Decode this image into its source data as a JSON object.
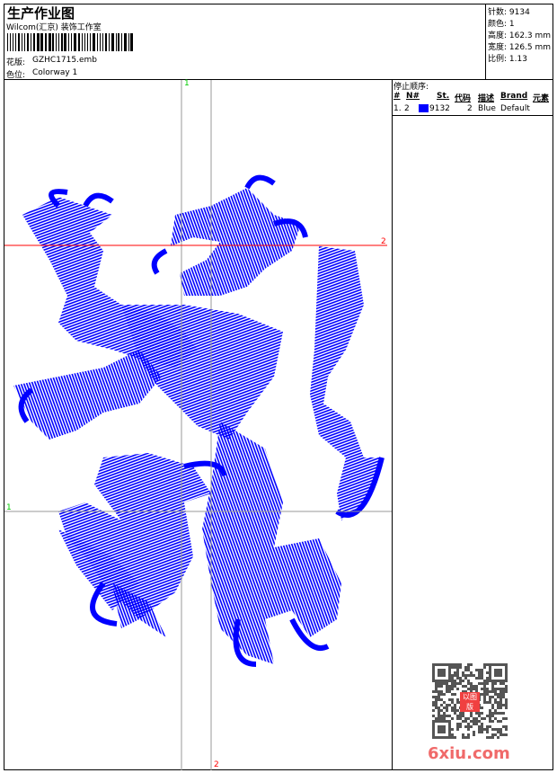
{
  "header": {
    "title": "生产作业图",
    "company": "Wilcom(汇京) 装饰工作室",
    "design_label": "花版:",
    "design_value": "GZHC1715.emb",
    "colorway_label": "色位:",
    "colorway_value": "Colorway 1"
  },
  "stats": {
    "stitches": "针数: 9134",
    "colors": "颜色: 1",
    "height": "高度: 162.3 mm",
    "width": "宽度: 126.5 mm",
    "scale": "比例: 1.13"
  },
  "stop_sequence": {
    "title": "停止顺序:",
    "headers": [
      "#",
      "N#",
      "St.",
      "代码",
      "描述",
      "Brand",
      "元素"
    ],
    "rows": [
      {
        "index": "1.",
        "needle": "2",
        "stitches": "9132",
        "code": "2",
        "description": "Blue",
        "brand": "Default"
      }
    ]
  },
  "markers": {
    "v1": "1",
    "v2": "2",
    "h1": "1",
    "h2": "2"
  },
  "colors": {
    "thread": "#0000ff",
    "marker_green": "#00cc00",
    "marker_red": "#ff0000"
  },
  "watermark": {
    "text": "6xiu.com",
    "seal": "以图版"
  }
}
